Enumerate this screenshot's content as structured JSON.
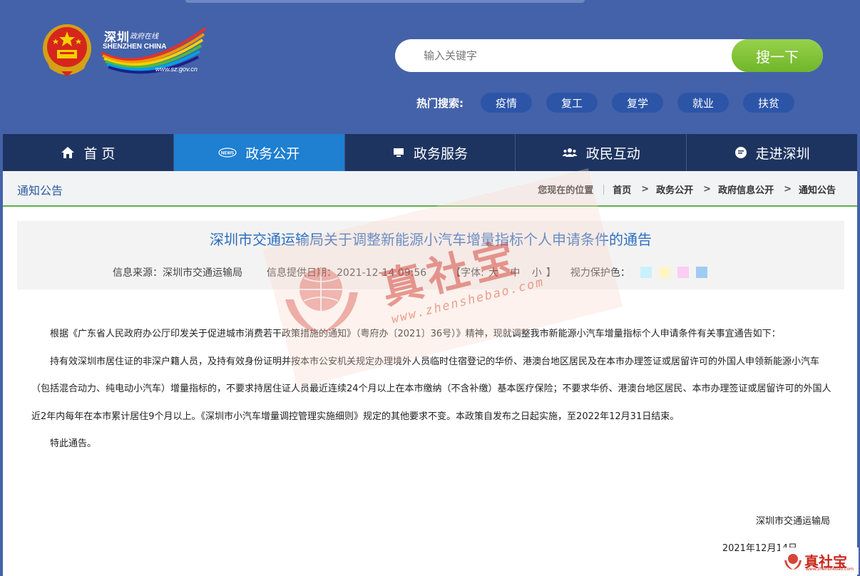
{
  "header": {
    "logo_cn": "深圳",
    "logo_cn_small": "政府在线",
    "logo_en": "SHENZHEN CHINA",
    "logo_url": "www.sz.gov.cn",
    "search_placeholder": "输入关键字",
    "search_button": "搜一下",
    "hot_label": "热门搜索:",
    "hot_tags": [
      "疫情",
      "复工",
      "复学",
      "就业",
      "扶贫"
    ]
  },
  "nav": {
    "items": [
      {
        "label": "首 页",
        "icon": "home-icon"
      },
      {
        "label": "政务公开",
        "icon": "news-icon"
      },
      {
        "label": "政务服务",
        "icon": "monitor-icon"
      },
      {
        "label": "政民互动",
        "icon": "people-icon"
      },
      {
        "label": "走进深圳",
        "icon": "chat-icon"
      }
    ],
    "active_index": 1
  },
  "section": {
    "title": "通知公告",
    "breadcrumb_label": "您现在的位置",
    "breadcrumb": [
      "首页",
      "政务公开",
      "政府信息公开",
      "通知公告"
    ]
  },
  "article": {
    "title": "深圳市交通运输局关于调整新能源小汽车增量指标个人申请条件的通告",
    "source": "信息来源：深圳市交通运输局",
    "date": "信息提供日期：2021-12-14 09:56",
    "font_label_open": "【字体:",
    "font_sizes": [
      "大",
      "中",
      "小"
    ],
    "font_label_close": "】",
    "eye_label": "视力保护色：",
    "eye_colors": [
      "#c9f1fb",
      "#fdf5c6",
      "#fbcdf2",
      "#9fcbf3"
    ],
    "paragraphs": [
      "根据《广东省人民政府办公厅印发关于促进城市消费若干政策措施的通知》（粤府办〔2021〕36号）》精神，现就调整我市新能源小汽车增量指标个人申请条件有关事宜通告如下：",
      "持有效深圳市居住证的非深户籍人员，及持有效身份证明并按本市公安机关规定办理境外人员临时住宿登记的华侨、港澳台地区居民及在本市办理签证或居留许可的外国人申领新能源小汽车（包括混合动力、纯电动小汽车）增量指标的，不要求持居住证人员最近连续24个月以上在本市缴纳（不含补缴）基本医疗保险；不要求华侨、港澳台地区居民、本市办理签证或居留许可的外国人近2年内每年在本市累计居住9个月以上。《深圳市小汽车增量调控管理实施细则》规定的其他要求不变。本政策自发布之日起实施，至2022年12月31日结束。",
      "特此通告。"
    ],
    "signoff": "深圳市交通运输局",
    "sign_date": "2021年12月14日"
  },
  "watermark": {
    "cn": "真社宝",
    "url": "www.zhenshebao.com",
    "badge_url": "www.zhenshebao.com"
  },
  "colors": {
    "header_bg": "#4462a9",
    "nav_bg": "#1e3460",
    "nav_active": "#1f7fd1",
    "search_btn": "#7dc232",
    "title_blue": "#2c6dc0",
    "accent_green": "#5cb24a"
  }
}
